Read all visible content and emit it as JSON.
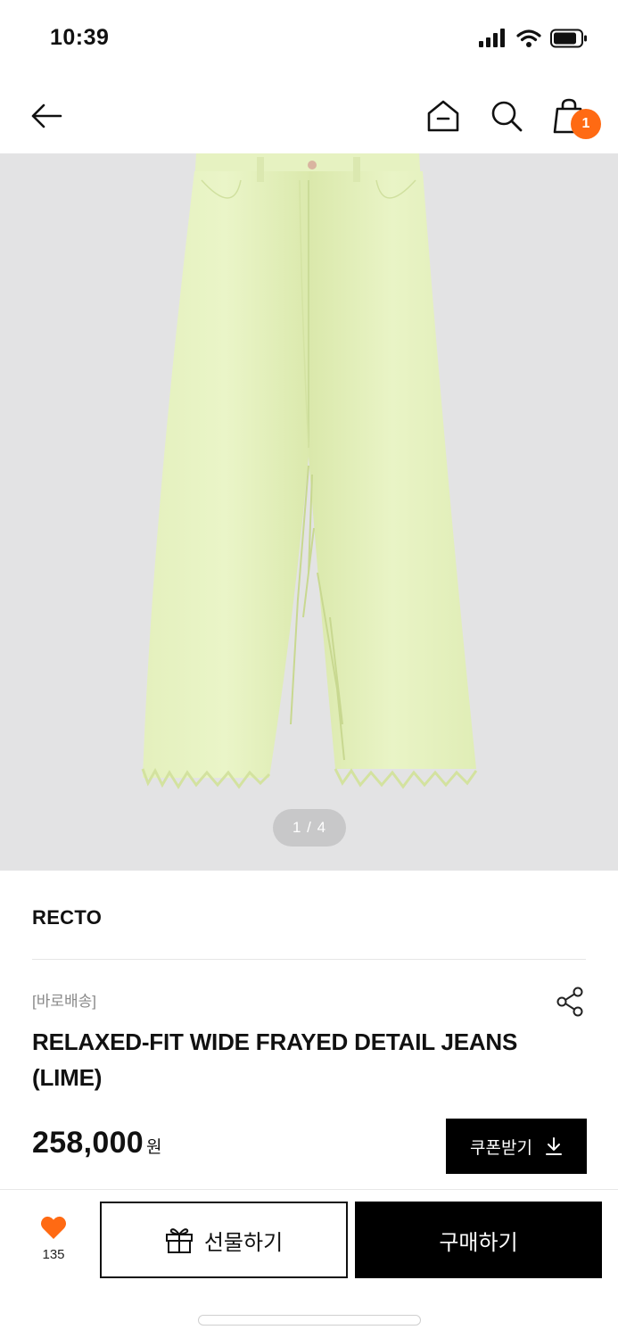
{
  "status_bar": {
    "time": "10:39"
  },
  "nav": {
    "back_icon": "arrow-left-icon",
    "home_icon": "home-icon",
    "search_icon": "search-icon",
    "cart_icon": "shopping-bag-icon",
    "cart_count": "1",
    "badge_color": "#ff6a13"
  },
  "gallery": {
    "counter": "1 / 4"
  },
  "product": {
    "brand": "RECTO",
    "shipping_tag": "[바로배송]",
    "title": "RELAXED-FIT WIDE FRAYED DETAIL JEANS (LIME)",
    "price": "258,000",
    "price_unit": "원",
    "share_icon": "share-icon"
  },
  "coupon": {
    "label": "쿠폰받기",
    "icon": "download-icon"
  },
  "bottom_bar": {
    "like_icon": "heart-icon",
    "like_color": "#ff6a13",
    "like_count": "135",
    "gift_label": "선물하기",
    "gift_icon": "gift-icon",
    "buy_label": "구매하기"
  }
}
